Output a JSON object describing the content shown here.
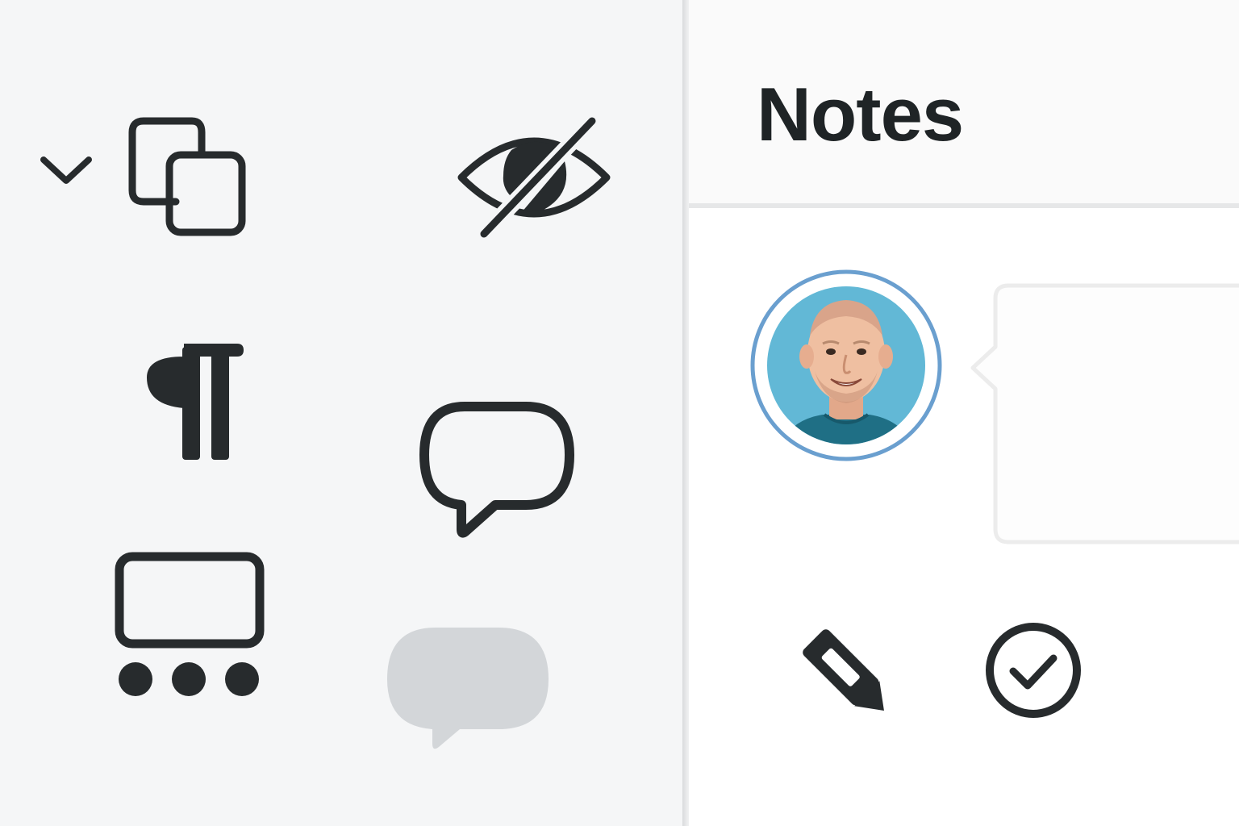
{
  "notes_panel": {
    "title": "Notes"
  },
  "colors": {
    "icon": "#272b2d",
    "muted_bubble": "#d3d6d9",
    "avatar_ring": "#6a9fcf",
    "avatar_background": "#62b8d6",
    "card_border": "#ececec"
  },
  "toolbar_icons": [
    {
      "name": "chevron-down-icon"
    },
    {
      "name": "copy-icon"
    },
    {
      "name": "eye-off-icon"
    },
    {
      "name": "paragraph-icon"
    },
    {
      "name": "comment-icon"
    },
    {
      "name": "slides-more-icon"
    },
    {
      "name": "comment-muted-icon"
    }
  ],
  "note_actions": [
    {
      "name": "edit-pencil-icon"
    },
    {
      "name": "resolve-check-icon"
    }
  ]
}
